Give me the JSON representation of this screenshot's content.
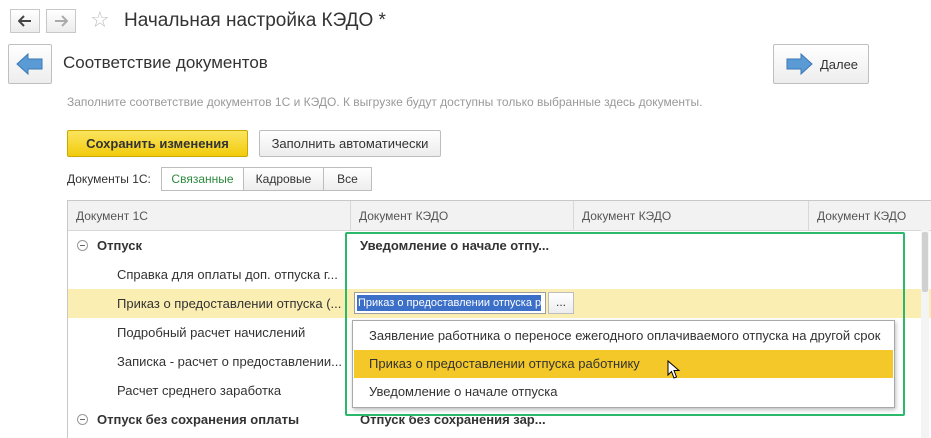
{
  "window": {
    "title": "Начальная настройка КЭДО *"
  },
  "page": {
    "title": "Соответствие документов",
    "hint": "Заполните соответствие документов 1С и КЭДО. К выгрузке будут доступны только выбранные здесь документы.",
    "next_label": "Далее"
  },
  "toolbar": {
    "save_label": "Сохранить изменения",
    "autofill_label": "Заполнить автоматически"
  },
  "filter": {
    "label": "Документы 1С:",
    "options": [
      "Связанные",
      "Кадровые",
      "Все"
    ],
    "selected": "Связанные"
  },
  "table": {
    "columns": [
      "Документ 1С",
      "Документ КЭДО",
      "Документ КЭДО",
      "Документ КЭДО"
    ],
    "rows": [
      {
        "doc1c": "Отпуск",
        "kedo": "Уведомление о начале отпу...",
        "group": true
      },
      {
        "doc1c": "Справка для оплаты доп. отпуска г...",
        "kedo": ""
      },
      {
        "doc1c": "Приказ о предоставлении отпуска (...",
        "kedo": "Приказ о предоставлении отпуска р",
        "selected": true
      },
      {
        "doc1c": "Подробный расчет начислений",
        "kedo": ""
      },
      {
        "doc1c": "Записка - расчет о предоставлении...",
        "kedo": ""
      },
      {
        "doc1c": "Расчет среднего заработка",
        "kedo": ""
      },
      {
        "doc1c": "Отпуск без сохранения оплаты",
        "kedo": "Отпуск без сохранения зар...",
        "group": true
      }
    ]
  },
  "dropdown": {
    "items": [
      "Заявление работника о переносе ежегодного оплачиваемого отпуска на другой срок",
      "Приказ о предоставлении отпуска работнику",
      "Уведомление о начале отпуска"
    ],
    "highlighted": "Приказ о предоставлении отпуска работнику"
  },
  "colors": {
    "primary_button": "#f2cb0c",
    "selected_row": "#fbeeb3",
    "highlight_item": "#f4c828",
    "annotation_frame": "#2bb86a",
    "active_filter_text": "#2d8a3e"
  }
}
